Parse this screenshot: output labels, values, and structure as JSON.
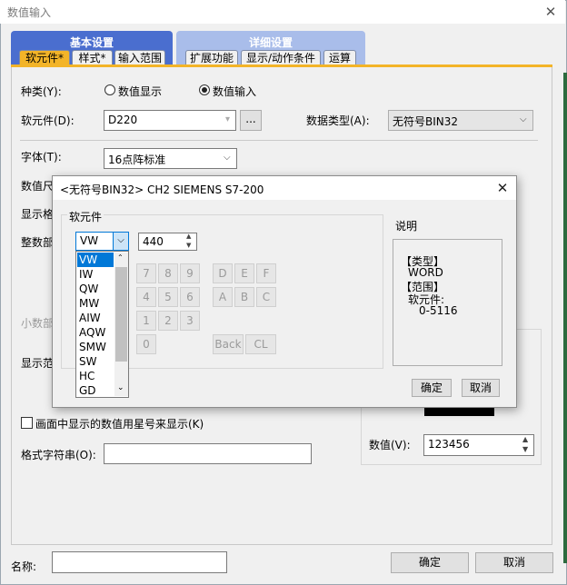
{
  "window": {
    "title": "数值输入",
    "close_glyph": "✕"
  },
  "tab_groups": [
    {
      "title": "基本设置",
      "tabs": [
        "软元件*",
        "样式*",
        "输入范围"
      ]
    },
    {
      "title": "详细设置",
      "tabs": [
        "扩展功能",
        "显示/动作条件",
        "运算"
      ]
    }
  ],
  "form": {
    "kind_label": "种类(Y):",
    "radio_display": "数值显示",
    "radio_input": "数值输入",
    "device_label": "软元件(D):",
    "device_value": "D220",
    "browse_label": "...",
    "datatype_label": "数据类型(A):",
    "datatype_value": "无符号BIN32",
    "font_label": "字体(T):",
    "font_value": "16点阵标准",
    "size_label_partial": "数值尺",
    "format_label_partial": "显示格",
    "integer_label_partial": "整数部",
    "decimal_label_partial": "小数部",
    "range_label_partial": "显示范",
    "asterisk_label": "画面中显示的数值用星号来显示(K)",
    "format_string_label": "格式字符串(O):",
    "format_string_value": "",
    "value_label": "数值(V):",
    "value_value": "123456"
  },
  "footer": {
    "name_label": "名称:",
    "name_value": "",
    "ok": "确定",
    "cancel": "取消"
  },
  "dialog": {
    "title": "<无符号BIN32> CH2 SIEMENS S7-200",
    "close_glyph": "✕",
    "group_label": "软元件",
    "device_type_selected": "VW",
    "device_number": "440",
    "device_types": [
      "VW",
      "IW",
      "QW",
      "MW",
      "AIW",
      "AQW",
      "SMW",
      "SW",
      "HC",
      "GD"
    ],
    "keypad": {
      "row1": [
        "7",
        "8",
        "9",
        "D",
        "E",
        "F"
      ],
      "row2": [
        "4",
        "5",
        "6",
        "A",
        "B",
        "C"
      ],
      "row3": [
        "1",
        "2",
        "3"
      ],
      "row4": [
        "0",
        "Back",
        "CL"
      ]
    },
    "desc_label": "说明",
    "desc_lines": [
      "【类型】",
      "WORD",
      "【范围】",
      "软元件:",
      "0-5116"
    ],
    "ok": "确定",
    "cancel": "取消"
  },
  "colors": {
    "active_tab": "#f3b428",
    "group1": "#4a6ecf",
    "group2": "#a9bdea",
    "list_selection": "#0078d7"
  }
}
